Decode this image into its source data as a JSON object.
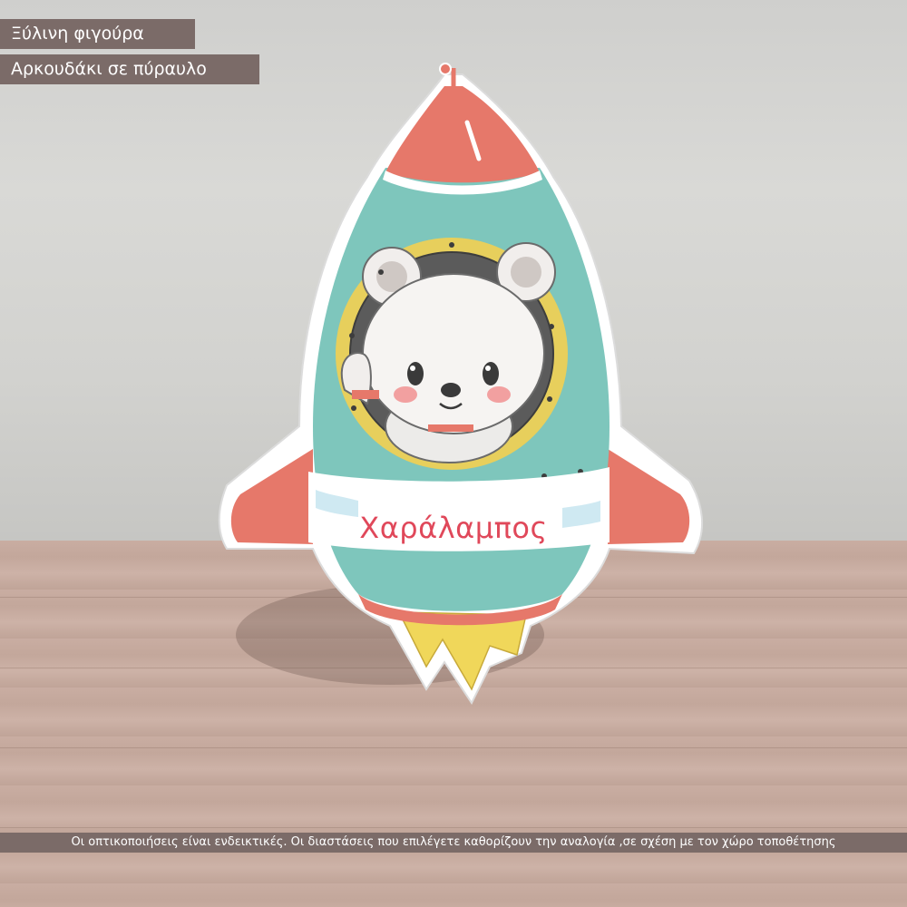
{
  "labels": {
    "product_type": "Ξύλινη φιγούρα",
    "product_name": "Αρκουδάκι σε πύραυλο"
  },
  "figure": {
    "name_text": "Χαράλαμπος"
  },
  "footer": {
    "disclaimer": "Οι οπτικοποιήσεις είναι ενδεικτικές. Οι διαστάσεις που επιλέγετε καθορίζουν την αναλογία ,σε σχέση με τον χώρο τοποθέτησης"
  },
  "colors": {
    "rocket_body": "#7ec6bc",
    "rocket_red": "#e6786a",
    "flame": "#f0d75a",
    "porthole_ring": "#e7cf5c",
    "name_text": "#e0485a"
  }
}
